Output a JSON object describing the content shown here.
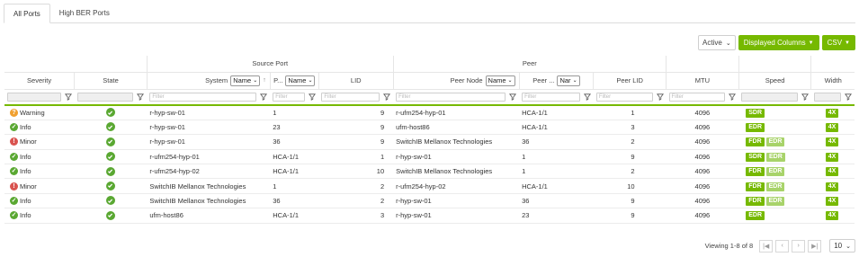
{
  "tabs": [
    {
      "label": "All Ports"
    },
    {
      "label": "High BER Ports"
    }
  ],
  "toolbar": {
    "status_filter": "Active",
    "displayed_columns_label": "Displayed Columns",
    "csv_label": "CSV"
  },
  "groups": {
    "source_port": "Source Port",
    "peer": "Peer"
  },
  "columns": {
    "severity": "Severity",
    "state": "State",
    "system": "System",
    "system_select": "Name",
    "port": "P...",
    "port_select": "Name",
    "lid": "LID",
    "peer_node": "Peer Node",
    "peer_node_select": "Name",
    "peer_port": "Peer ...",
    "peer_port_select": "Nar",
    "peer_lid": "Peer LID",
    "mtu": "MTU",
    "speed": "Speed",
    "width": "Width"
  },
  "filter_placeholder": "Filter",
  "colors": {
    "accent": "#76b900",
    "accent_light": "#a8d36a",
    "warning": "#f0a030",
    "info": "#5aa832",
    "minor": "#d9534f"
  },
  "rows": [
    {
      "severity": "Warning",
      "sev_type": "warn",
      "system": "r-hyp-sw-01",
      "port": "1",
      "lid": "9",
      "peer_node": "r-ufm254-hyp-01",
      "peer_port": "HCA-1/1",
      "peer_lid": "1",
      "mtu": "4096",
      "speed": [
        "SDR"
      ],
      "width": "4X"
    },
    {
      "severity": "Info",
      "sev_type": "info",
      "system": "r-hyp-sw-01",
      "port": "23",
      "lid": "9",
      "peer_node": "ufm-host86",
      "peer_port": "HCA-1/1",
      "peer_lid": "3",
      "mtu": "4096",
      "speed": [
        "EDR"
      ],
      "width": "4X"
    },
    {
      "severity": "Minor",
      "sev_type": "minor",
      "system": "r-hyp-sw-01",
      "port": "36",
      "lid": "9",
      "peer_node": "SwitchIB Mellanox Technologies",
      "peer_port": "36",
      "peer_lid": "2",
      "mtu": "4096",
      "speed": [
        "FDR",
        "EDR"
      ],
      "width": "4X"
    },
    {
      "severity": "Info",
      "sev_type": "info",
      "system": "r-ufm254-hyp-01",
      "port": "HCA-1/1",
      "lid": "1",
      "peer_node": "r-hyp-sw-01",
      "peer_port": "1",
      "peer_lid": "9",
      "mtu": "4096",
      "speed": [
        "SDR",
        "EDR"
      ],
      "width": "4X"
    },
    {
      "severity": "Info",
      "sev_type": "info",
      "system": "r-ufm254-hyp-02",
      "port": "HCA-1/1",
      "lid": "10",
      "peer_node": "SwitchIB Mellanox Technologies",
      "peer_port": "1",
      "peer_lid": "2",
      "mtu": "4096",
      "speed": [
        "FDR",
        "EDR"
      ],
      "width": "4X"
    },
    {
      "severity": "Minor",
      "sev_type": "minor",
      "system": "SwitchIB Mellanox Technologies",
      "port": "1",
      "lid": "2",
      "peer_node": "r-ufm254-hyp-02",
      "peer_port": "HCA-1/1",
      "peer_lid": "10",
      "mtu": "4096",
      "speed": [
        "FDR",
        "EDR"
      ],
      "width": "4X"
    },
    {
      "severity": "Info",
      "sev_type": "info",
      "system": "SwitchIB Mellanox Technologies",
      "port": "36",
      "lid": "2",
      "peer_node": "r-hyp-sw-01",
      "peer_port": "36",
      "peer_lid": "9",
      "mtu": "4096",
      "speed": [
        "FDR",
        "EDR"
      ],
      "width": "4X"
    },
    {
      "severity": "Info",
      "sev_type": "info",
      "system": "ufm-host86",
      "port": "HCA-1/1",
      "lid": "3",
      "peer_node": "r-hyp-sw-01",
      "peer_port": "23",
      "peer_lid": "9",
      "mtu": "4096",
      "speed": [
        "EDR"
      ],
      "width": "4X"
    }
  ],
  "pager": {
    "viewing_text": "Viewing 1-8 of 8",
    "page_size": "10"
  }
}
